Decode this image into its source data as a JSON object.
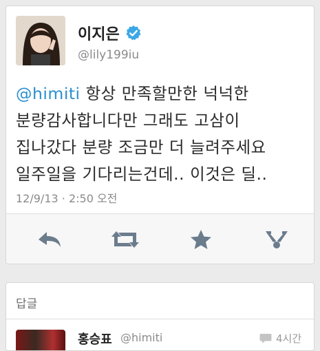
{
  "tweet": {
    "author_name": "이지은",
    "author_handle": "@lily199iu",
    "mention": "@himiti",
    "text_lines": [
      " 항상 만족할만한 넉넉한",
      "분량감사합니다만 그래도 고삼이",
      "집나갔다 분량 조금만 더 늘려주세요",
      "일주일을 기다리는건데.. 이것은 딜.."
    ],
    "timestamp": "12/9/13 · 2:50 오전"
  },
  "actions": {
    "reply_icon": "reply-icon",
    "retweet_icon": "retweet-icon",
    "favorite_icon": "star-icon",
    "more_icon": "share-icon"
  },
  "replies": {
    "title": "답글",
    "first": {
      "name": "홍승표",
      "handle": "@himiti",
      "time": "4시간"
    }
  },
  "colors": {
    "mention": "#2b8fcf",
    "verified": "#3ba7e6",
    "icon": "#6b7c8c"
  }
}
